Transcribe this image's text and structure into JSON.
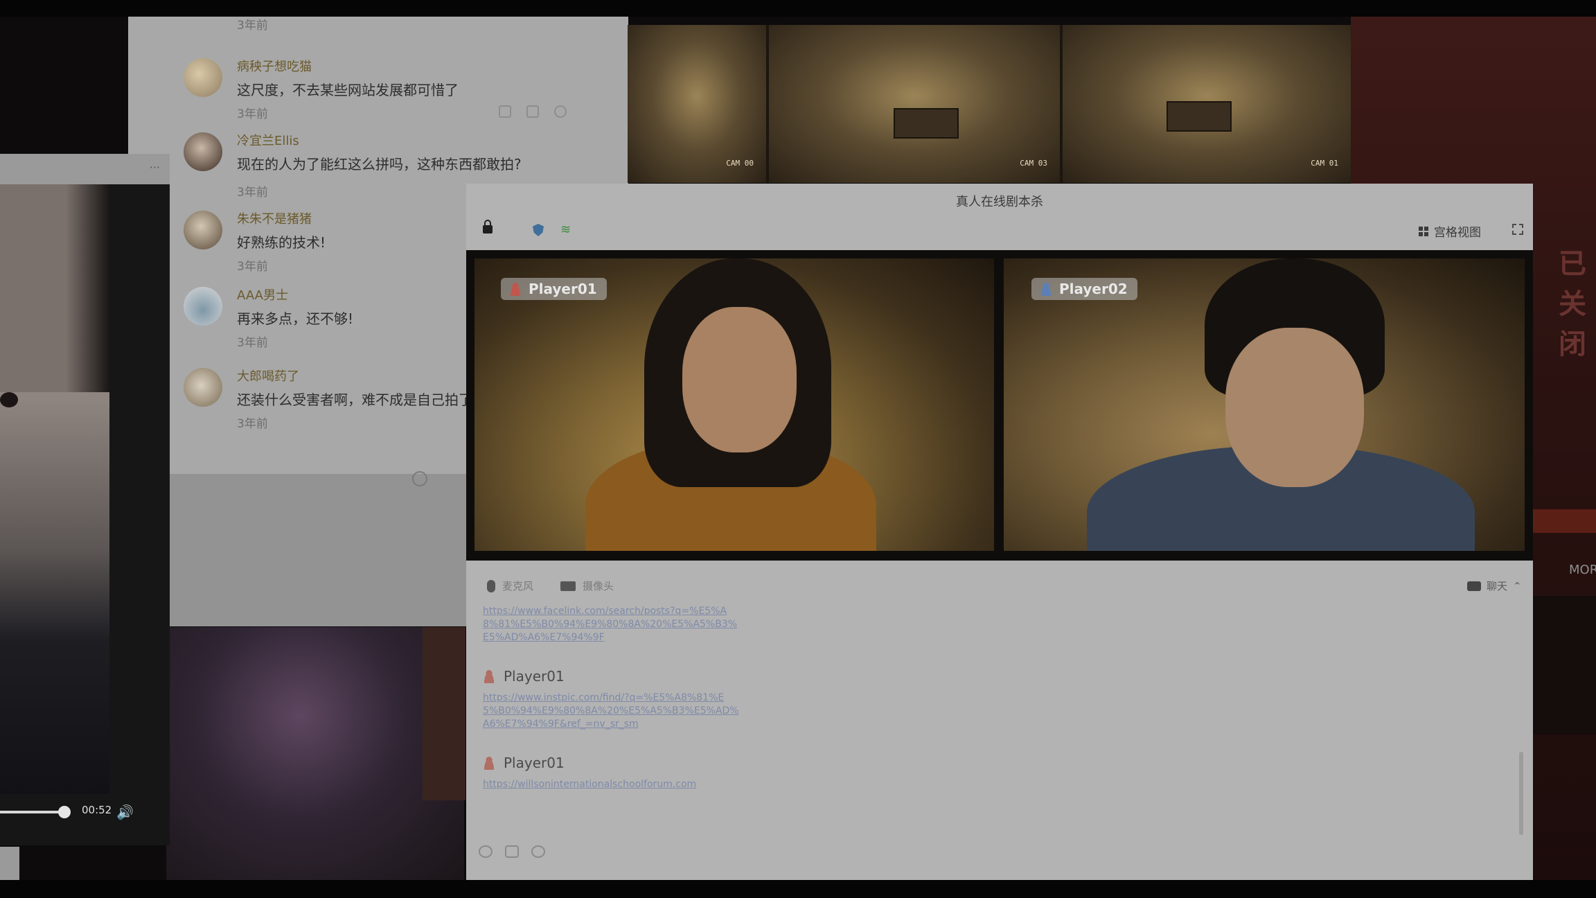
{
  "comments": {
    "first_time": "3年前",
    "items": [
      {
        "author": "病秧子想吃猫",
        "text": "这尺度，不去某些网站发展都可惜了",
        "time": "3年前"
      },
      {
        "author": "冷宜兰Ellis",
        "text": "现在的人为了能红这么拼吗，这种东西都敢拍?",
        "time": "3年前"
      },
      {
        "author": "朱朱不是猪猪",
        "text": "好熟练的技术!",
        "time": "3年前"
      },
      {
        "author": "AAA男士",
        "text": "再来多点，还不够!",
        "time": "3年前"
      },
      {
        "author": "大郎喝药了",
        "text": "还装什么受害者啊，难不成是自己拍了",
        "time": "3年前"
      }
    ]
  },
  "player": {
    "more": "···",
    "time": "00:52",
    "progress": 0.4
  },
  "cctv": {
    "cams": [
      "CAM 00",
      "CAM 03",
      "CAM 01"
    ]
  },
  "side": {
    "red_text": "已关闭",
    "more": "MOR"
  },
  "call": {
    "title": "真人在线剧本杀",
    "grid_view": "宫格视图",
    "players": [
      "Player01",
      "Player02"
    ],
    "mic": "麦克风",
    "camera": "摄像头",
    "chat_toggle": "聊天",
    "messages": [
      {
        "sender": "",
        "link": "https://www.facelink.com/search/posts?q=%E5%A8%81%E5%B0%94%E9%80%8A%20%E5%A5%B3%E5%AD%A6%E7%94%9F"
      },
      {
        "sender": "Player01",
        "link": "https://www.instpic.com/find/?q=%E5%A8%81%E5%B0%94%E9%80%8A%20%E5%A5%B3%E5%AD%A6%E7%94%9F&ref_=nv_sr_sm"
      },
      {
        "sender": "Player01",
        "link": "https://willsoninternationalschoolforum.com"
      }
    ]
  },
  "colors": {
    "background": "#0d0b0b",
    "window": "#b3b3b3",
    "link": "#7e8aa8",
    "author": "#6b5a2c"
  }
}
